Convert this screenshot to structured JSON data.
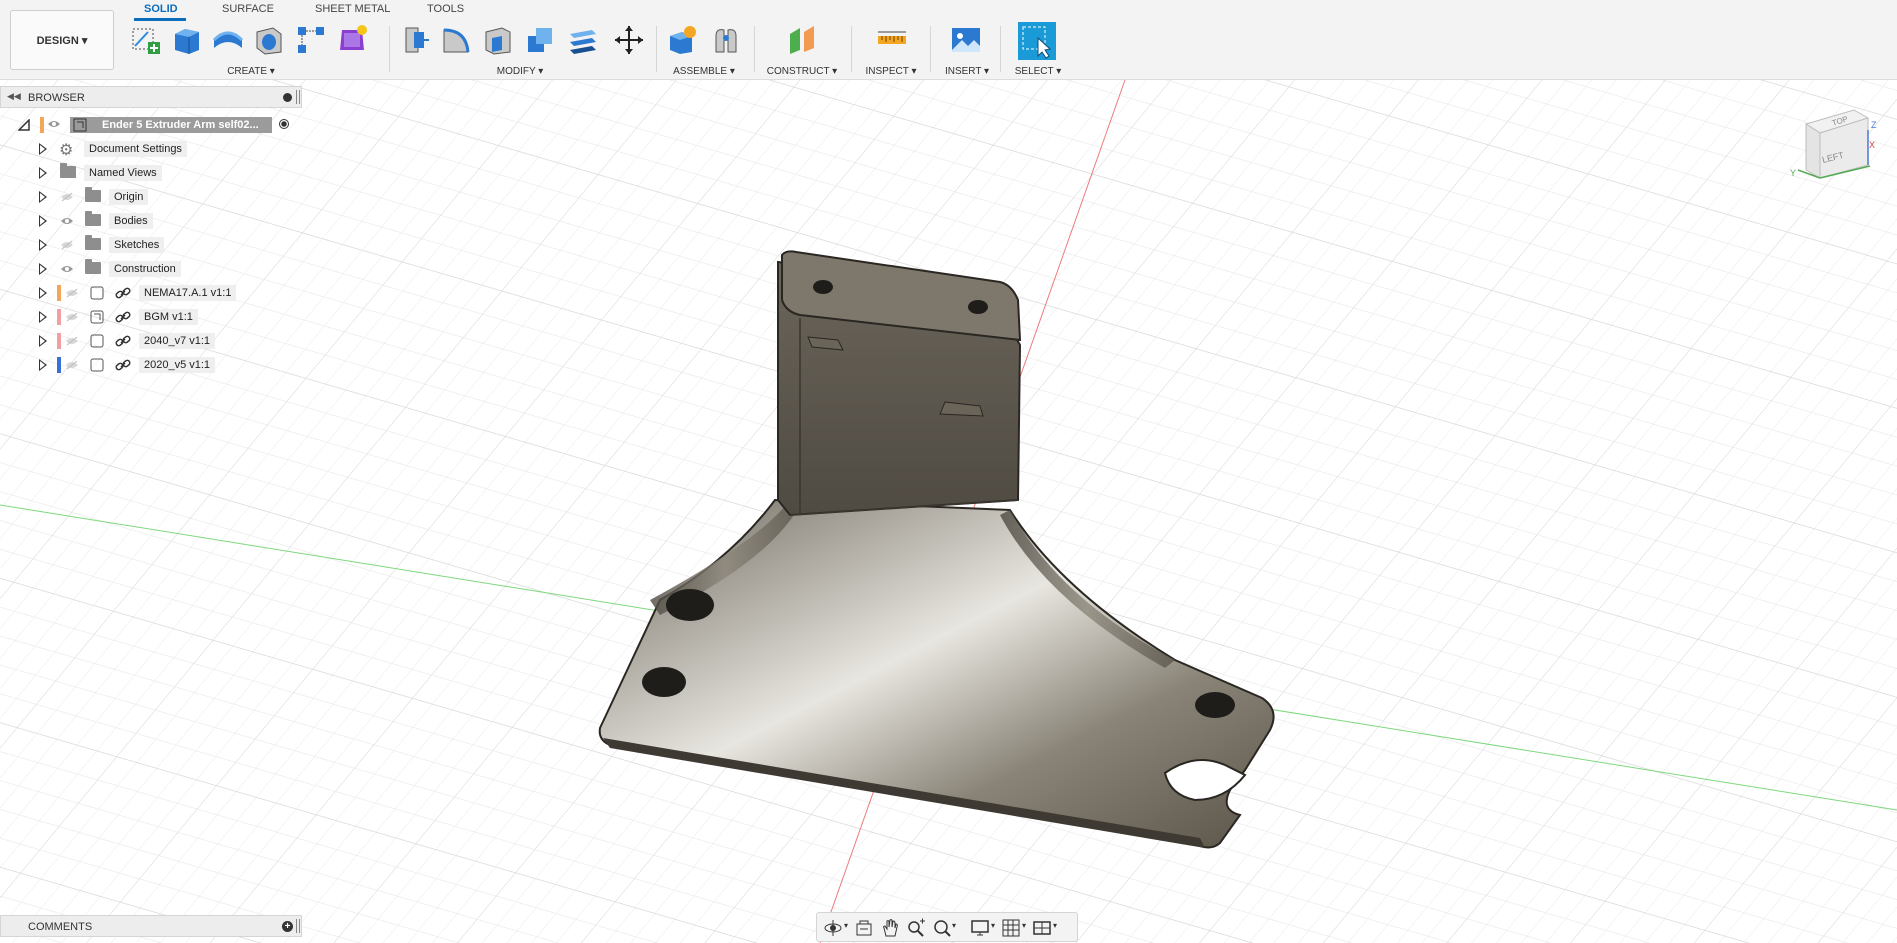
{
  "workspace": {
    "label": "DESIGN ▾"
  },
  "tabs": [
    {
      "label": "SOLID",
      "active": true
    },
    {
      "label": "SURFACE",
      "active": false
    },
    {
      "label": "SHEET METAL",
      "active": false
    },
    {
      "label": "TOOLS",
      "active": false
    }
  ],
  "groups": {
    "create": "CREATE ▾",
    "modify": "MODIFY ▾",
    "assemble": "ASSEMBLE ▾",
    "construct": "CONSTRUCT ▾",
    "inspect": "INSPECT ▾",
    "insert": "INSERT ▾",
    "select": "SELECT ▾"
  },
  "browser": {
    "title": "BROWSER",
    "root": "Ender 5 Extruder Arm self02...",
    "items": [
      {
        "label": "Document Settings",
        "icon": "gear-icon"
      },
      {
        "label": "Named Views",
        "icon": "folder-icon"
      },
      {
        "label": "Origin",
        "icon": "folder-icon"
      },
      {
        "label": "Bodies",
        "icon": "folder-icon"
      },
      {
        "label": "Sketches",
        "icon": "folder-icon"
      },
      {
        "label": "Construction",
        "icon": "folder-icon"
      },
      {
        "label": "NEMA17.A.1 v1:1",
        "icon": "component-link-icon",
        "color": "#f2a65a"
      },
      {
        "label": "BGM v1:1",
        "icon": "component-link-icon",
        "color": "#f0a0a0"
      },
      {
        "label": "2040_v7 v1:1",
        "icon": "component-link-icon",
        "color": "#f0a0a0"
      },
      {
        "label": "2020_v5 v1:1",
        "icon": "component-link-icon",
        "color": "#3a6fd8"
      }
    ]
  },
  "viewcube": {
    "face_top": "TOP",
    "face_left": "LEFT",
    "axis_x": "X",
    "axis_y": "Y",
    "axis_z": "Z"
  },
  "comments": {
    "title": "COMMENTS"
  },
  "colors": {
    "accent": "#0a6ebd",
    "select_button": "#1a9bd8",
    "x_axis": "#e05050",
    "y_axis": "#60c060"
  }
}
